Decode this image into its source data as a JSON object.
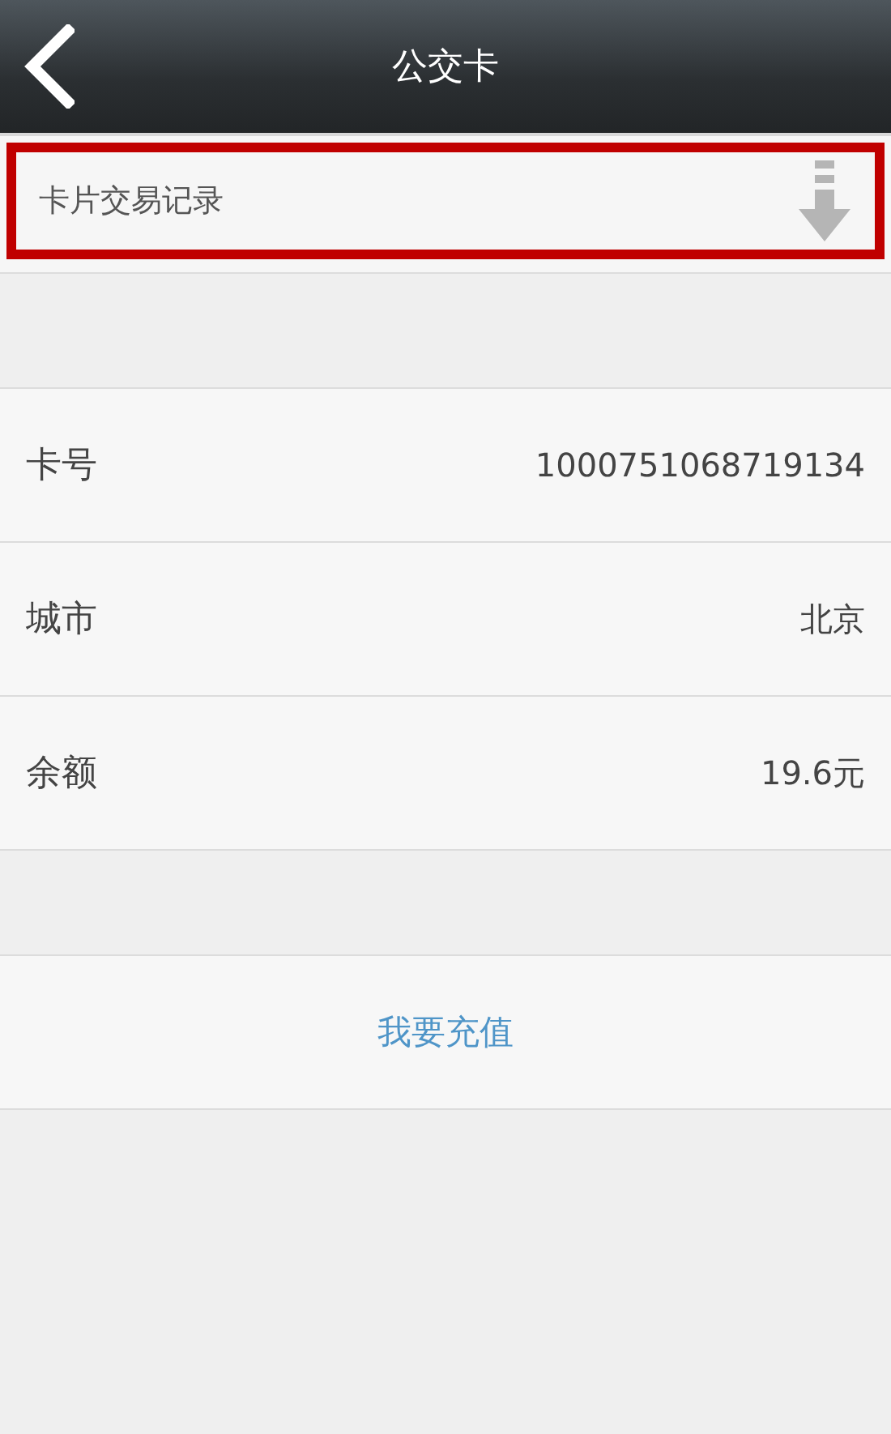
{
  "header": {
    "title": "公交卡"
  },
  "records": {
    "label": "卡片交易记录",
    "highlighted": true
  },
  "details": [
    {
      "label": "卡号",
      "value": "1000751068719134"
    },
    {
      "label": "城市",
      "value": "北京"
    },
    {
      "label": "余额",
      "value": "19.6元"
    }
  ],
  "action": {
    "label": "我要充值"
  }
}
